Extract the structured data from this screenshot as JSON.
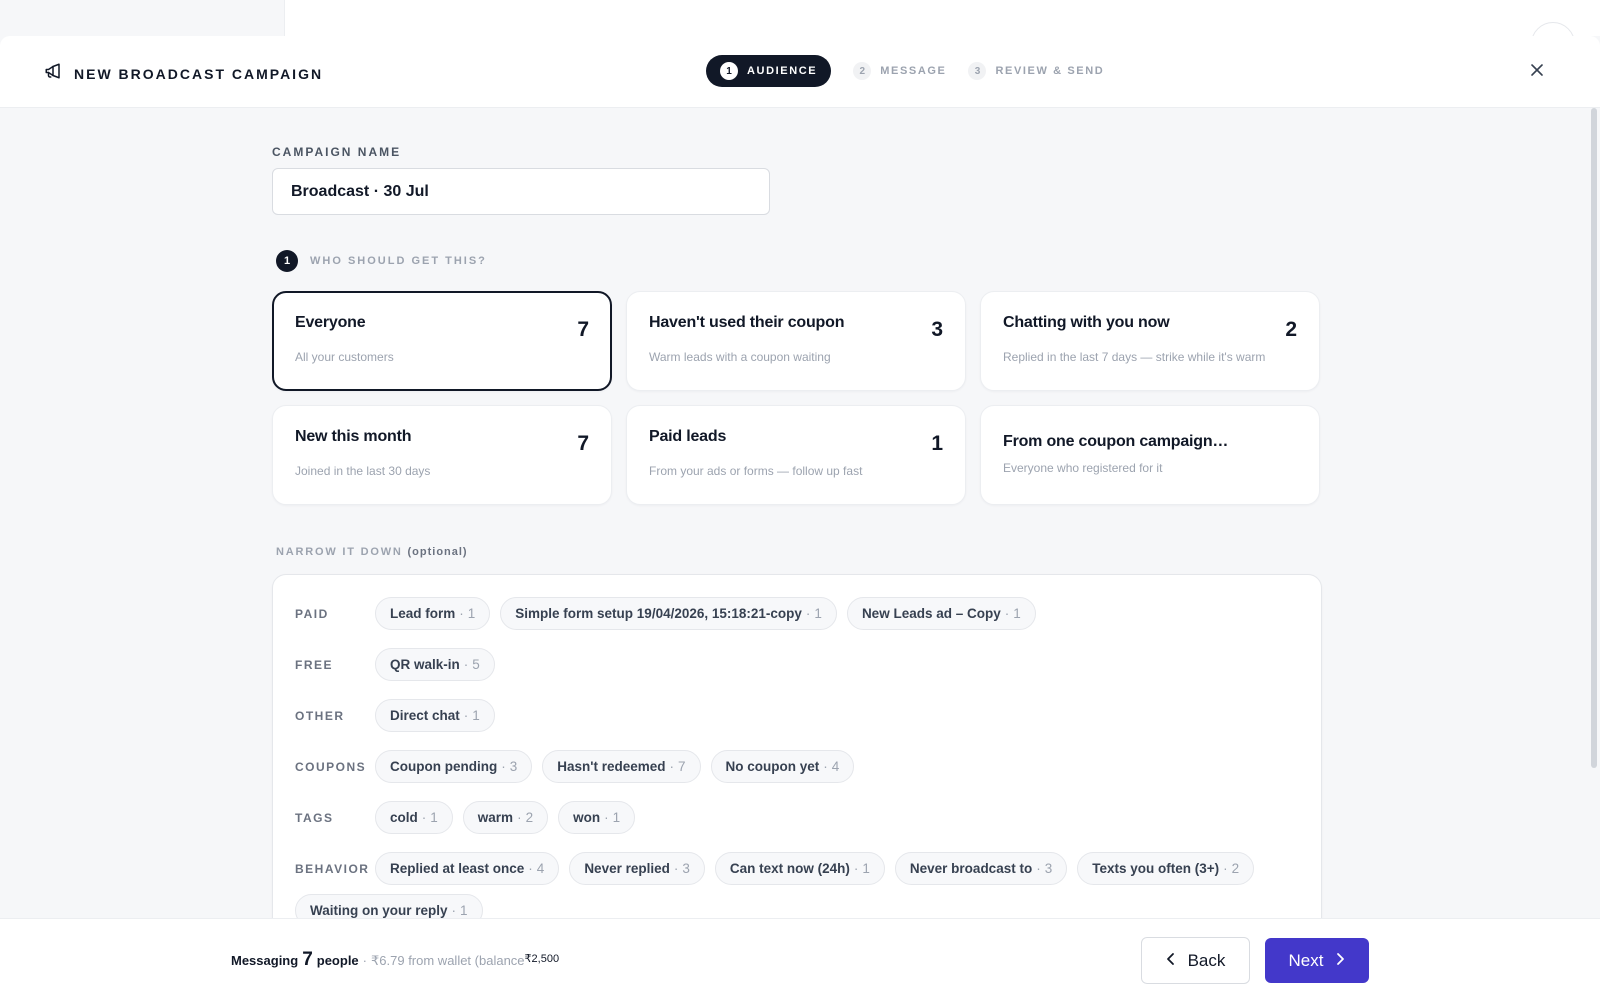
{
  "header": {
    "title": "NEW BROADCAST CAMPAIGN",
    "steps": [
      {
        "num": "1",
        "label": "AUDIENCE"
      },
      {
        "num": "2",
        "label": "MESSAGE"
      },
      {
        "num": "3",
        "label": "REVIEW & SEND"
      }
    ],
    "active_step": 1
  },
  "campaign": {
    "label": "CAMPAIGN NAME",
    "value": "Broadcast · 30 Jul"
  },
  "question": {
    "num": "1",
    "text": "WHO SHOULD GET THIS?"
  },
  "audiences": [
    {
      "title": "Everyone",
      "subtitle": "All your customers",
      "count": "7",
      "selected": true
    },
    {
      "title": "Haven't used their coupon",
      "subtitle": "Warm leads with a coupon waiting",
      "count": "3",
      "selected": false
    },
    {
      "title": "Chatting with you now",
      "subtitle": "Replied in the last 7 days — strike while it's warm",
      "count": "2",
      "selected": false
    },
    {
      "title": "New this month",
      "subtitle": "Joined in the last 30 days",
      "count": "7",
      "selected": false
    },
    {
      "title": "Paid leads",
      "subtitle": "From your ads or forms — follow up fast",
      "count": "1",
      "selected": false
    },
    {
      "title": "From one coupon campaign…",
      "subtitle": "Everyone who registered for it",
      "count": "",
      "selected": false
    }
  ],
  "narrow": {
    "label": "NARROW IT DOWN",
    "optional": "(optional)",
    "groups": [
      {
        "label": "PAID",
        "chips": [
          {
            "name": "Lead form",
            "count": "1"
          },
          {
            "name": "Simple form setup 19/04/2026, 15:18:21-copy",
            "count": "1"
          },
          {
            "name": "New Leads ad – Copy",
            "count": "1"
          }
        ]
      },
      {
        "label": "FREE",
        "chips": [
          {
            "name": "QR walk-in",
            "count": "5"
          }
        ]
      },
      {
        "label": "OTHER",
        "chips": [
          {
            "name": "Direct chat",
            "count": "1"
          }
        ]
      },
      {
        "label": "COUPONS",
        "chips": [
          {
            "name": "Coupon pending",
            "count": "3"
          },
          {
            "name": "Hasn't redeemed",
            "count": "7"
          },
          {
            "name": "No coupon yet",
            "count": "4"
          }
        ]
      },
      {
        "label": "TAGS",
        "chips": [
          {
            "name": "cold",
            "count": "1"
          },
          {
            "name": "warm",
            "count": "2"
          },
          {
            "name": "won",
            "count": "1"
          }
        ]
      },
      {
        "label": "BEHAVIOR",
        "chips": [
          {
            "name": "Replied at least once",
            "count": "4"
          },
          {
            "name": "Never replied",
            "count": "3"
          },
          {
            "name": "Can text now (24h)",
            "count": "1"
          },
          {
            "name": "Never broadcast to",
            "count": "3"
          },
          {
            "name": "Texts you often (3+)",
            "count": "2"
          },
          {
            "name": "Waiting on your reply",
            "count": "1"
          }
        ]
      }
    ]
  },
  "footer": {
    "messaging": "Messaging",
    "people_count": "7",
    "people": "people",
    "sep": "·",
    "cost": "₹6.79 from wallet (balance",
    "balance": "₹2,500",
    "back_label": "Back",
    "next_label": "Next"
  },
  "colors": {
    "primary": "#4338ca",
    "dark": "#111827",
    "background": "#f6f7f9"
  }
}
